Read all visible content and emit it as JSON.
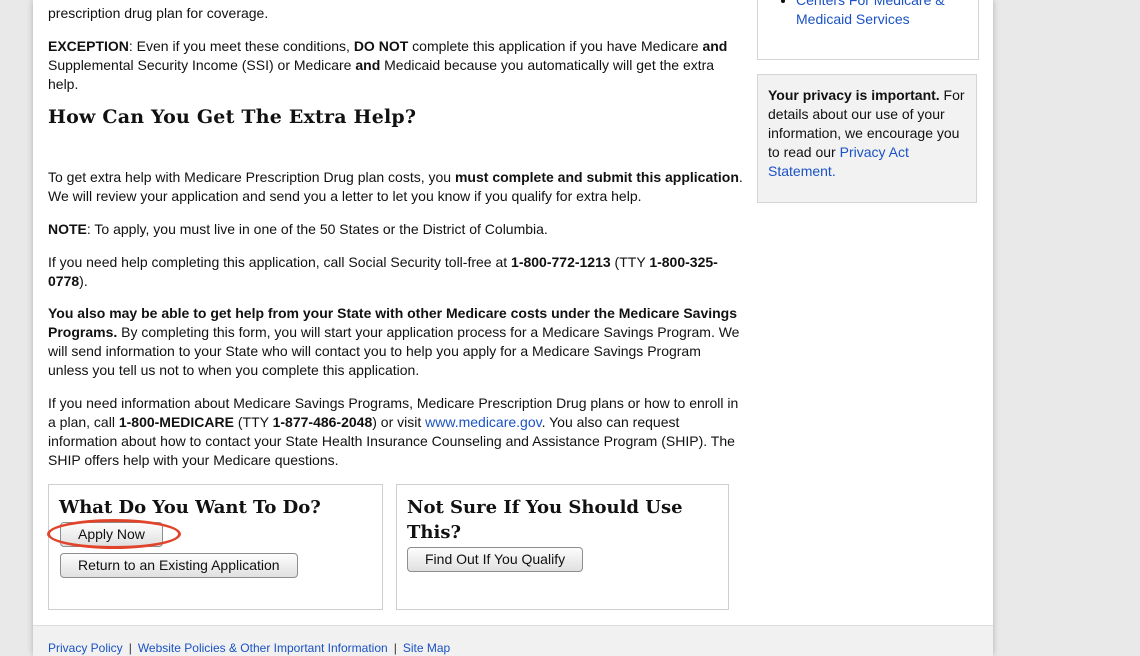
{
  "intro": {
    "bullet_tail": "prescription drug plan for coverage."
  },
  "exception": {
    "label": "EXCEPTION",
    "t1": ": Even if you meet these conditions, ",
    "do_not": "DO NOT",
    "t2": " complete this application if you have Medicare ",
    "and1": "and",
    "t3": " Supplemental Security Income (SSI) or Medicare ",
    "and2": "and",
    "t4": " Medicaid because you automatically will get the extra help."
  },
  "section_title": "How Can You Get The Extra Help?",
  "para1": {
    "t1": "To get extra help with Medicare Prescription Drug plan costs, you ",
    "bold": "must complete and submit this application",
    "t2": ". We will review your application and send you a letter to let you know if you qualify for extra help."
  },
  "note": {
    "label": "NOTE",
    "text": ": To apply, you must live in one of the 50 States or the District of Columbia."
  },
  "help": {
    "t1": "If you need help completing this application, call Social Security toll-free at ",
    "phone": "1-800-772-1213",
    "t2": " (TTY ",
    "tty": "1-800-325-0778",
    "t3": ")."
  },
  "msp": {
    "bold": "You also may be able to get help from your State with other Medicare costs under the Medicare Savings Programs.",
    "text": " By completing this form, you will start your application process for a Medicare Savings Program. We will send information to your State who will contact you to help you apply for a Medicare Savings Program unless you tell us not to when you complete this application."
  },
  "info": {
    "t1": "If you need information about Medicare Savings Programs, Medicare Prescription Drug plans or how to enroll in a plan, call ",
    "phone": "1-800-MEDICARE",
    "t2": " (TTY ",
    "tty": "1-877-486-2048",
    "t3": ") or visit ",
    "link": "www.medicare.gov",
    "t4": ". You also can request information about how to contact your State Health Insurance Counseling and Assistance Program (SHIP). The SHIP offers help with your Medicare questions."
  },
  "box_do": {
    "title": "What Do You Want To Do?",
    "apply_label": "Apply Now",
    "return_label": "Return to an Existing Application"
  },
  "box_sure": {
    "title": "Not Sure If You Should Use This?",
    "qualify_label": "Find Out If You Qualify"
  },
  "sidebar": {
    "link_text": "Centers For Medicare & Medicaid Services",
    "privacy_bold": "Your privacy is important.",
    "privacy_text": " For details about our use of your information, we encourage you to read our ",
    "privacy_link": "Privacy Act Statement."
  },
  "footer": {
    "links": [
      "Privacy Policy",
      "Website Policies & Other Important Information",
      "Site Map"
    ],
    "separator": "|"
  },
  "colors": {
    "link": "#1a52c4",
    "highlight": "#e0452b"
  }
}
